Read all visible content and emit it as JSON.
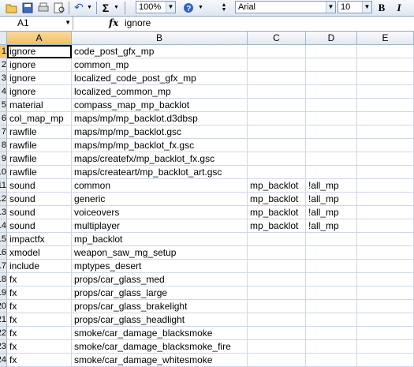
{
  "toolbar": {
    "zoom": "100%",
    "font_name": "Arial",
    "font_size": "10",
    "bold_label": "B",
    "italic_label": "I"
  },
  "formula_bar": {
    "name_box": "A1",
    "fx_label": "fx",
    "content": "ignore"
  },
  "columns": [
    "A",
    "B",
    "C",
    "D",
    "E"
  ],
  "rows": [
    {
      "num": "1",
      "a": "ignore",
      "b": "code_post_gfx_mp",
      "c": "",
      "d": ""
    },
    {
      "num": "2",
      "a": "ignore",
      "b": "common_mp",
      "c": "",
      "d": ""
    },
    {
      "num": "3",
      "a": "ignore",
      "b": "localized_code_post_gfx_mp",
      "c": "",
      "d": ""
    },
    {
      "num": "4",
      "a": "ignore",
      "b": "localized_common_mp",
      "c": "",
      "d": ""
    },
    {
      "num": "5",
      "a": "material",
      "b": "compass_map_mp_backlot",
      "c": "",
      "d": ""
    },
    {
      "num": "6",
      "a": "col_map_mp",
      "b": "maps/mp/mp_backlot.d3dbsp",
      "c": "",
      "d": ""
    },
    {
      "num": "7",
      "a": "rawfile",
      "b": "maps/mp/mp_backlot.gsc",
      "c": "",
      "d": ""
    },
    {
      "num": "8",
      "a": "rawfile",
      "b": "maps/mp/mp_backlot_fx.gsc",
      "c": "",
      "d": ""
    },
    {
      "num": "9",
      "a": "rawfile",
      "b": "maps/createfx/mp_backlot_fx.gsc",
      "c": "",
      "d": ""
    },
    {
      "num": "10",
      "a": "rawfile",
      "b": "maps/createart/mp_backlot_art.gsc",
      "c": "",
      "d": ""
    },
    {
      "num": "11",
      "a": "sound",
      "b": "common",
      "c": "mp_backlot",
      "d": "!all_mp"
    },
    {
      "num": "12",
      "a": "sound",
      "b": "generic",
      "c": "mp_backlot",
      "d": "!all_mp"
    },
    {
      "num": "13",
      "a": "sound",
      "b": "voiceovers",
      "c": "mp_backlot",
      "d": "!all_mp"
    },
    {
      "num": "14",
      "a": "sound",
      "b": "multiplayer",
      "c": "mp_backlot",
      "d": "!all_mp"
    },
    {
      "num": "15",
      "a": "impactfx",
      "b": "mp_backlot",
      "c": "",
      "d": ""
    },
    {
      "num": "16",
      "a": "xmodel",
      "b": "weapon_saw_mg_setup",
      "c": "",
      "d": ""
    },
    {
      "num": "17",
      "a": "include",
      "b": "mptypes_desert",
      "c": "",
      "d": ""
    },
    {
      "num": "18",
      "a": "fx",
      "b": "props/car_glass_med",
      "c": "",
      "d": ""
    },
    {
      "num": "19",
      "a": "fx",
      "b": "props/car_glass_large",
      "c": "",
      "d": ""
    },
    {
      "num": "20",
      "a": "fx",
      "b": "props/car_glass_brakelight",
      "c": "",
      "d": ""
    },
    {
      "num": "21",
      "a": "fx",
      "b": "props/car_glass_headlight",
      "c": "",
      "d": ""
    },
    {
      "num": "22",
      "a": "fx",
      "b": "smoke/car_damage_blacksmoke",
      "c": "",
      "d": ""
    },
    {
      "num": "23",
      "a": "fx",
      "b": "smoke/car_damage_blacksmoke_fire",
      "c": "",
      "d": ""
    },
    {
      "num": "24",
      "a": "fx",
      "b": "smoke/car_damage_whitesmoke",
      "c": "",
      "d": ""
    }
  ]
}
